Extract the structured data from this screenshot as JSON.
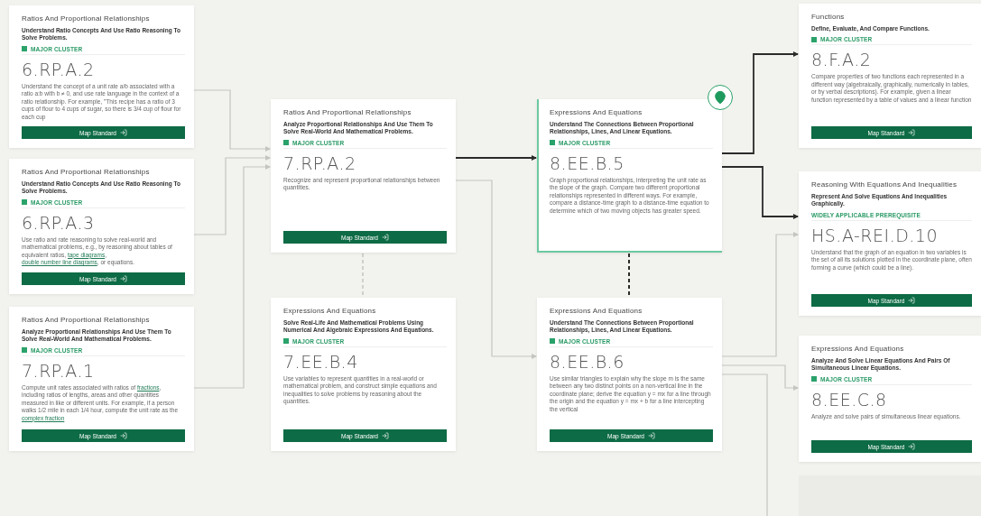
{
  "cards": [
    {
      "category": "Ratios And Proportional Relationships",
      "cluster_heading": "Understand Ratio Concepts And Use Ratio Reasoning To Solve Problems.",
      "cluster": {
        "kind": "major",
        "label": "MAJOR CLUSTER"
      },
      "code": "6.RP.A.2",
      "description": [
        {
          "kind": "text",
          "text": "Understand the concept of a unit rate a/b associated with a ratio a:b with b ≠ 0, and use rate language in the context of a ratio relationship. For example, \"This recipe has a ratio of 3 cups of flour to 4 cups of sugar, so there is 3/4 cup of flour for each cup"
        }
      ],
      "button": "Map Standard",
      "selected": false
    },
    {
      "category": "Ratios And Proportional Relationships",
      "cluster_heading": "Understand Ratio Concepts And Use Ratio Reasoning To Solve Problems.",
      "cluster": {
        "kind": "major",
        "label": "MAJOR CLUSTER"
      },
      "code": "6.RP.A.3",
      "description": [
        {
          "kind": "text",
          "text": "Use ratio and rate reasoning to solve real-world and mathematical problems, e.g., by reasoning about tables of equivalent ratios, "
        },
        {
          "kind": "link",
          "text": "tape diagrams"
        },
        {
          "kind": "text",
          "text": ", "
        },
        {
          "kind": "link",
          "text": "double number line diagrams"
        },
        {
          "kind": "text",
          "text": ", or equations."
        }
      ],
      "button": "Map Standard",
      "selected": false
    },
    {
      "category": "Ratios And Proportional Relationships",
      "cluster_heading": "Analyze Proportional Relationships And Use Them To Solve Real-World And Mathematical Problems.",
      "cluster": {
        "kind": "major",
        "label": "MAJOR CLUSTER"
      },
      "code": "7.RP.A.1",
      "description": [
        {
          "kind": "text",
          "text": "Compute unit rates associated with ratios of "
        },
        {
          "kind": "link",
          "text": "fractions"
        },
        {
          "kind": "text",
          "text": ", including ratios of lengths, areas and other quantities measured in like or different units. For example, if a person walks 1/2 mile in each 1/4 hour, compute the unit rate as the "
        },
        {
          "kind": "link",
          "text": "complex fraction"
        }
      ],
      "button": "Map Standard",
      "selected": false
    },
    {
      "category": "Ratios And Proportional Relationships",
      "cluster_heading": "Analyze Proportional Relationships And Use Them To Solve Real-World And Mathematical Problems.",
      "cluster": {
        "kind": "major",
        "label": "MAJOR CLUSTER"
      },
      "code": "7.RP.A.2",
      "description": [
        {
          "kind": "text",
          "text": "Recognize and represent proportional relationships between quantities."
        }
      ],
      "button": "Map Standard",
      "selected": false
    },
    {
      "category": "Expressions And Equations",
      "cluster_heading": "Solve Real-Life And Mathematical Problems Using Numerical And Algebraic Expressions And Equations.",
      "cluster": {
        "kind": "major",
        "label": "MAJOR CLUSTER"
      },
      "code": "7.EE.B.4",
      "description": [
        {
          "kind": "text",
          "text": "Use variables to represent quantities in a real-world or mathematical problem, and construct simple equations and inequalities to solve problems by reasoning about the quantities."
        }
      ],
      "button": "Map Standard",
      "selected": false
    },
    {
      "category": "Expressions And Equations",
      "cluster_heading": "Understand The Connections Between Proportional Relationships, Lines, And Linear Equations.",
      "cluster": {
        "kind": "major",
        "label": "MAJOR CLUSTER"
      },
      "code": "8.EE.B.5",
      "description": [
        {
          "kind": "text",
          "text": "Graph proportional relationships, interpreting the unit rate as the slope of the graph. Compare two different proportional relationships represented in different ways. For example, compare a distance-time graph to a distance-time equation to determine which of two moving objects has greater speed."
        }
      ],
      "selected": true
    },
    {
      "category": "Expressions And Equations",
      "cluster_heading": "Understand The Connections Between Proportional Relationships, Lines, And Linear Equations.",
      "cluster": {
        "kind": "major",
        "label": "MAJOR CLUSTER"
      },
      "code": "8.EE.B.6",
      "description": [
        {
          "kind": "text",
          "text": "Use similar triangles to explain why the slope m is the same between any two distinct points on a non-vertical line in the coordinate plane; derive the equation y = mx for a line through the origin and the equation y = mx + b for a line intercepting the vertical"
        }
      ],
      "button": "Map Standard",
      "selected": false
    },
    {
      "category": "Functions",
      "cluster_heading": "Define, Evaluate, And Compare Functions.",
      "cluster": {
        "kind": "major",
        "label": "MAJOR CLUSTER"
      },
      "code": "8.F.A.2",
      "description": [
        {
          "kind": "text",
          "text": "Compare properties of two functions each represented in a different way (algebraically, graphically, numerically in tables, or by verbal descriptions). For example, given a linear function represented by a table of values and a linear function"
        }
      ],
      "button": "Map Standard",
      "selected": false
    },
    {
      "category": "Reasoning With Equations And Inequalities",
      "cluster_heading": "Represent And Solve Equations And Inequalities Graphically.",
      "cluster": {
        "kind": "prerequisite",
        "label": "WIDELY APPLICABLE PREREQUISITE"
      },
      "code": "HS.A-REI.D.10",
      "description": [
        {
          "kind": "text",
          "text": "Understand that the graph of an equation in two variables is the set of all its solutions plotted in the coordinate plane, often forming a curve (which could be a line)."
        }
      ],
      "button": "Map Standard",
      "selected": false
    },
    {
      "category": "Expressions And Equations",
      "cluster_heading": "Analyze And Solve Linear Equations And Pairs Of Simultaneous Linear Equations.",
      "cluster": {
        "kind": "major",
        "label": "MAJOR CLUSTER"
      },
      "code": "8.EE.C.8",
      "description": [
        {
          "kind": "text",
          "text": "Analyze and solve pairs of simultaneous linear equations."
        }
      ],
      "button": "Map Standard",
      "selected": false
    }
  ]
}
